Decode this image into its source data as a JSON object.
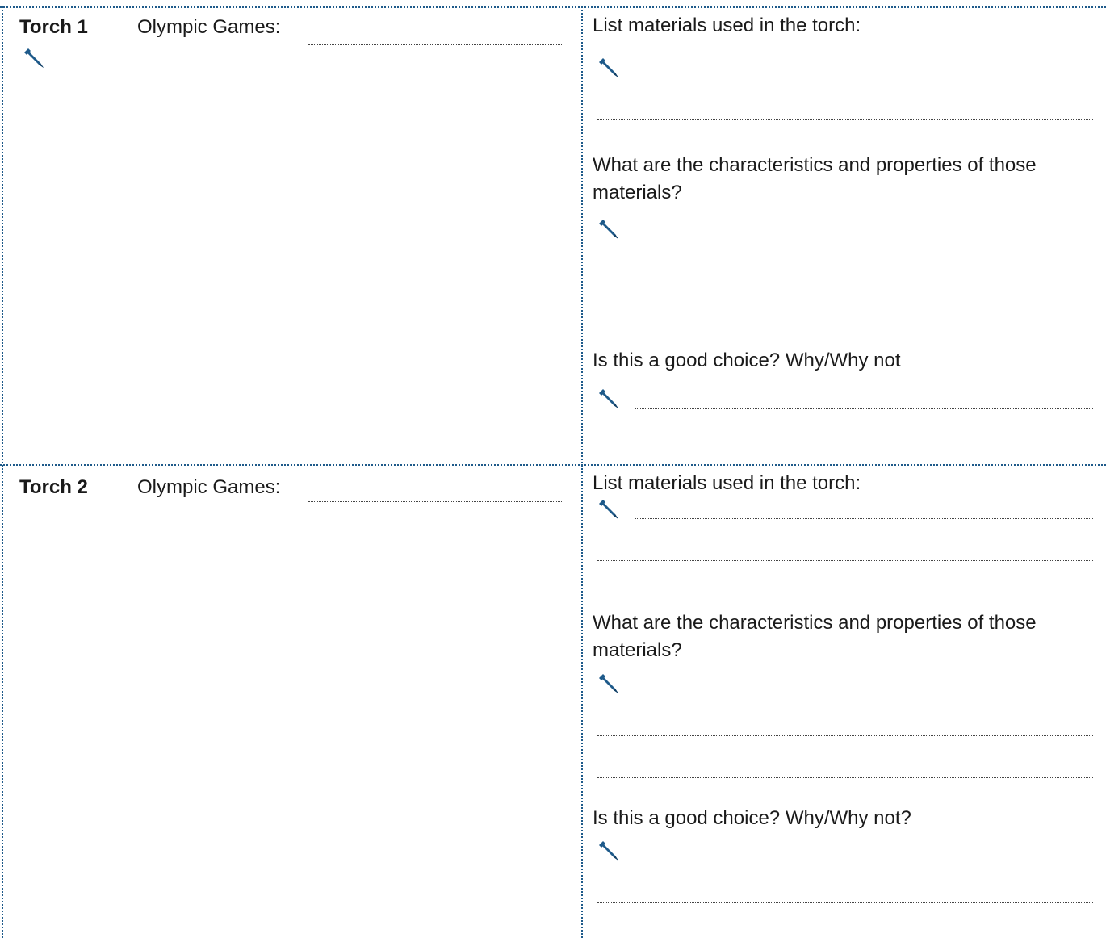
{
  "colors": {
    "accent": "#1e5a8a",
    "text": "#1a1a1a",
    "answer_line": "#444444"
  },
  "icon": "pencil-icon",
  "torches": [
    {
      "title": "Torch 1",
      "games_label": "Olympic Games:",
      "questions": [
        "List materials used in the torch:",
        "What are the characteristics and properties of those materials?",
        "Is this a good choice? Why/Why not"
      ]
    },
    {
      "title": "Torch 2",
      "games_label": "Olympic Games:",
      "questions": [
        "List materials used in the torch:",
        "What are the characteristics and properties of those materials?",
        "Is this a good choice? Why/Why not?"
      ]
    }
  ]
}
